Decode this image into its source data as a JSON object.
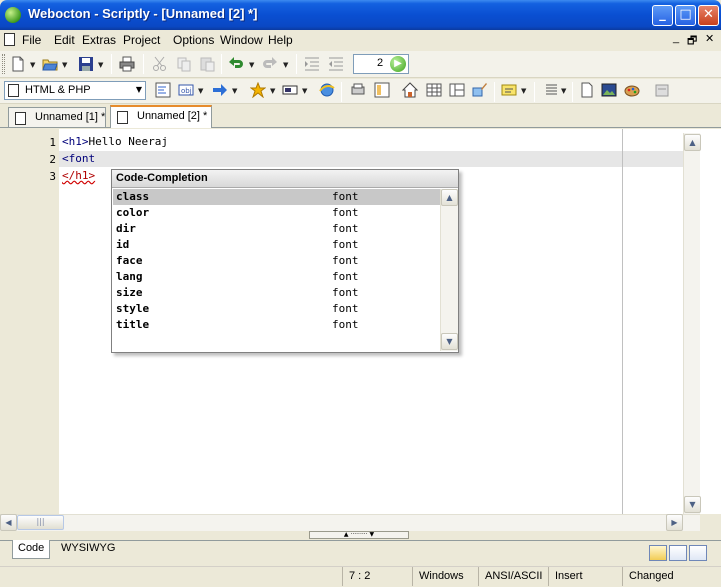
{
  "window": {
    "title": "Webocton - Scriptly - [Unnamed [2] *]",
    "controls": {
      "minimize": "_",
      "maximize": "□",
      "close": "✕"
    }
  },
  "menu": {
    "items": [
      "File",
      "Edit",
      "Extras",
      "Project",
      "Options",
      "Window",
      "Help"
    ],
    "mdi_controls": {
      "minimize": "_",
      "restore": "🗗",
      "close": "✕"
    }
  },
  "toolbar": {
    "counter_value": "2"
  },
  "language_select": {
    "value": "HTML & PHP"
  },
  "tabs": [
    {
      "label": "Unnamed [1] *",
      "active": false
    },
    {
      "label": "Unnamed [2] *",
      "active": true
    }
  ],
  "editor": {
    "line_numbers": [
      "1",
      "2",
      "3"
    ],
    "lines": {
      "l1_tag": "<h1>",
      "l1_text": "Hello Neeraj",
      "l2": "<font",
      "l3": "</h1>"
    }
  },
  "completion": {
    "header": "Code-Completion",
    "items": [
      {
        "attr": "class",
        "element": "font",
        "selected": true
      },
      {
        "attr": "color",
        "element": "font",
        "selected": false
      },
      {
        "attr": "dir",
        "element": "font",
        "selected": false
      },
      {
        "attr": "id",
        "element": "font",
        "selected": false
      },
      {
        "attr": "face",
        "element": "font",
        "selected": false
      },
      {
        "attr": "lang",
        "element": "font",
        "selected": false
      },
      {
        "attr": "size",
        "element": "font",
        "selected": false
      },
      {
        "attr": "style",
        "element": "font",
        "selected": false
      },
      {
        "attr": "title",
        "element": "font",
        "selected": false
      }
    ]
  },
  "view_tabs": [
    {
      "label": "Code",
      "active": true
    },
    {
      "label": "WYSIWYG",
      "active": false
    }
  ],
  "status": {
    "position": "7 : 2",
    "line_endings": "Windows",
    "encoding": "ANSI/ASCII",
    "mode": "Insert",
    "state": "Changed"
  },
  "colors": {
    "titlebar": "#0a4fd2",
    "tag_text": "#00007a",
    "error_text": "#b00000",
    "active_tab_accent": "#e68b2c",
    "selection": "#c8c8c8"
  },
  "icons": [
    "new-file-icon",
    "open-folder-icon",
    "save-icon",
    "print-icon",
    "cut-icon",
    "copy-icon",
    "paste-icon",
    "undo-icon",
    "redo-icon",
    "indent-icon",
    "outdent-icon",
    "go-icon",
    "favorites-star-icon",
    "forward-arrow-icon",
    "browser-preview-icon",
    "home-icon",
    "table-icon",
    "image-icon",
    "palette-icon"
  ]
}
